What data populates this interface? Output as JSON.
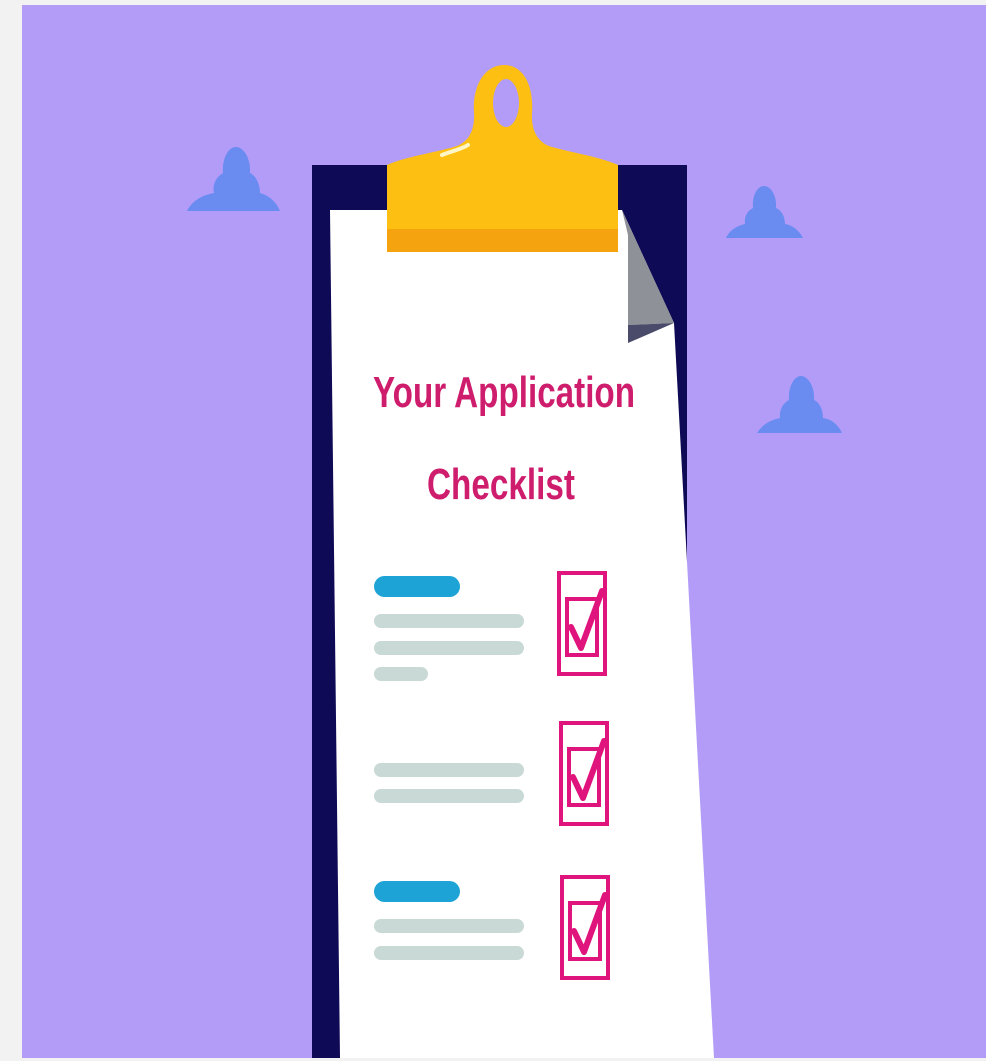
{
  "illustration": {
    "title_line_1": "Your Application",
    "title_line_2": "Checklist"
  },
  "colors": {
    "background": "#b39cf8",
    "cloud": "#6a8cf0",
    "board": "#0f0a55",
    "paper": "#ffffff",
    "paper_fold": "#8f9199",
    "clip": "#fcbf12",
    "clip_band": "#f5a30e",
    "title": "#cf1d6e",
    "accent_line": "#1ea3d6",
    "text_line": "#c9d9d6",
    "checkbox": "#e0147d"
  },
  "checklist": [
    {
      "checked": true,
      "has_heading": true
    },
    {
      "checked": true,
      "has_heading": false
    },
    {
      "checked": true,
      "has_heading": true
    }
  ]
}
